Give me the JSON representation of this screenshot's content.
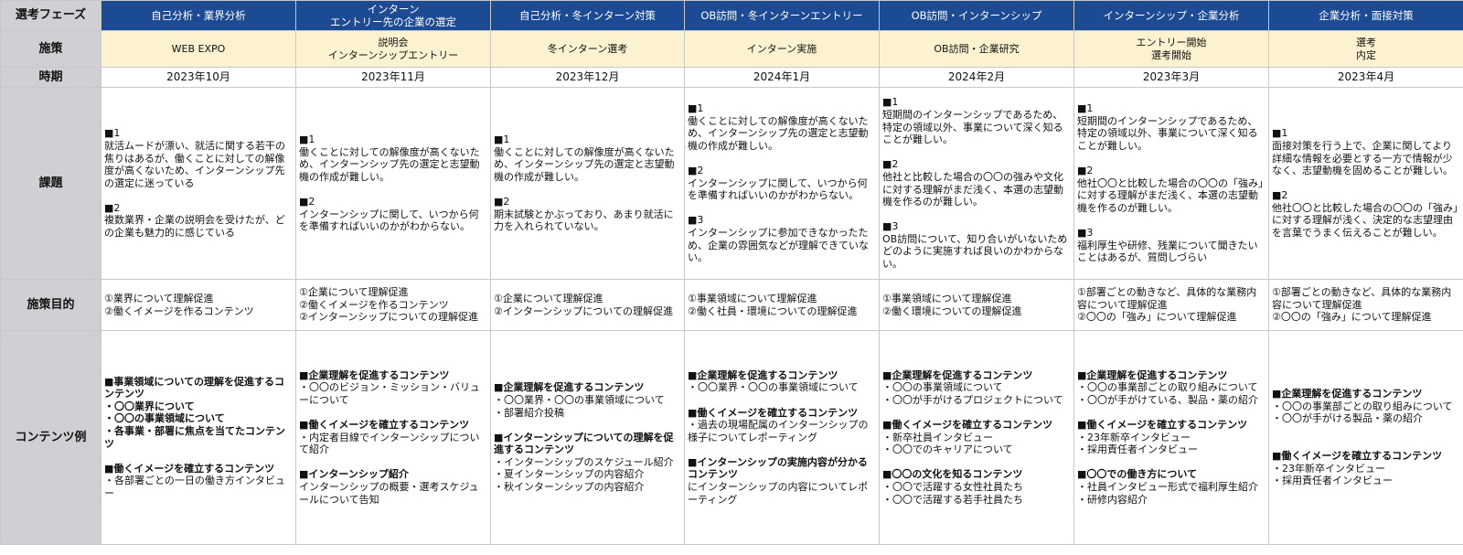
{
  "row_headers": {
    "phase": "選考フェーズ",
    "measure": "施策",
    "period": "時期",
    "challenges": "課題",
    "purpose": "施策目的",
    "content": "コンテンツ例"
  },
  "columns": [
    {
      "phase": "自己分析・業界分析",
      "measure": "WEB EXPO",
      "period": "2023年10月",
      "challenges": "■1\n就活ムードが漂い、就活に関する若干の焦りはあるが、働くことに対しての解像度が高くないため、インターンシップ先の選定に迷っている\n\n■2\n複数業界・企業の説明会を受けたが、どの企業も魅力的に感じている",
      "purpose": "①業界について理解促進\n②働くイメージを作るコンテンツ",
      "content": [
        {
          "text": "■事業領域についての理解を促進するコンテンツ",
          "bold": true
        },
        {
          "text": "・〇〇業界について",
          "bold": true
        },
        {
          "text": "・〇〇の事業領域について",
          "bold": true
        },
        {
          "text": "・各事業・部署に焦点を当てたコンテンツ",
          "bold": true
        },
        {
          "text": "",
          "bold": false
        },
        {
          "text": "■働くイメージを確立するコンテンツ",
          "bold": true
        },
        {
          "text": "・各部署ごとの一日の働き方インタビュー",
          "bold": false
        }
      ]
    },
    {
      "phase": "インターン\nエントリー先の企業の選定",
      "measure": "説明会\nインターンシップエントリー",
      "period": "2023年11月",
      "challenges": "■1\n働くことに対しての解像度が高くないため、インターンシップ先の選定と志望動機の作成が難しい。\n\n■2\nインターンシップに関して、いつから何を準備すればいいのかがわからない。",
      "purpose": "①企業について理解促進\n②働くイメージを作るコンテンツ\n②インターンシップについての理解促進",
      "content": [
        {
          "text": "■企業理解を促進するコンテンツ",
          "bold": true
        },
        {
          "text": "・〇〇のビジョン・ミッション・バリューについて",
          "bold": false
        },
        {
          "text": "",
          "bold": false
        },
        {
          "text": "■働くイメージを確立するコンテンツ",
          "bold": true
        },
        {
          "text": "・内定者目線でインターンシップについて紹介",
          "bold": false
        },
        {
          "text": "",
          "bold": false
        },
        {
          "text": "■インターンシップ紹介",
          "bold": true
        },
        {
          "text": "インターンシップの概要・選考スケジュールについて告知",
          "bold": false
        }
      ]
    },
    {
      "phase": "自己分析・冬インターン対策",
      "measure": "冬インターン選考",
      "period": "2023年12月",
      "challenges": "■1\n働くことに対しての解像度が高くないため、インターンシップ先の選定と志望動機の作成が難しい。\n\n■2\n期末試験とかぶっており、あまり就活に力を入れられていない。",
      "purpose": "①企業について理解促進\n②インターンシップについての理解促進",
      "content": [
        {
          "text": "■企業理解を促進するコンテンツ",
          "bold": true
        },
        {
          "text": "・〇〇業界・〇〇の事業領域について",
          "bold": false
        },
        {
          "text": "・部署紹介投稿",
          "bold": false
        },
        {
          "text": "",
          "bold": false
        },
        {
          "text": "■インターンシップについての理解を促進するコンテンツ",
          "bold": true
        },
        {
          "text": "・インターンシップのスケジュール紹介",
          "bold": false
        },
        {
          "text": "・夏インターンシップの内容紹介",
          "bold": false
        },
        {
          "text": "・秋インターンシップの内容紹介",
          "bold": false
        }
      ]
    },
    {
      "phase": "OB訪問・冬インターンエントリー",
      "measure": "インターン実施",
      "period": "2024年1月",
      "challenges": "■1\n働くことに対しての解像度が高くないため、インターンシップ先の選定と志望動機の作成が難しい。\n\n■2\nインターンシップに関して、いつから何を準備すればいいのかがわからない。\n\n■3\nインターンシップに参加できなかったため、企業の雰囲気などが理解できていない。",
      "purpose": "①事業領域について理解促進\n②働く社員・環境についての理解促進",
      "content": [
        {
          "text": "■企業理解を促進するコンテンツ",
          "bold": true
        },
        {
          "text": "・〇〇業界・〇〇の事業領域について",
          "bold": false
        },
        {
          "text": "",
          "bold": false
        },
        {
          "text": "■働くイメージを確立するコンテンツ",
          "bold": true
        },
        {
          "text": "・過去の現場配属のインターンシップの様子についてレポーティング",
          "bold": false
        },
        {
          "text": "",
          "bold": false
        },
        {
          "text": "■インターンシップの実施内容が分かるコンテンツ",
          "bold": true
        },
        {
          "text": "にインターンシップの内容についてレポーティング",
          "bold": false
        }
      ]
    },
    {
      "phase": "OB訪問・インターンシップ",
      "measure": "OB訪問・企業研究",
      "period": "2024年2月",
      "challenges": "■1\n短期間のインターンシップであるため、特定の領域以外、事業について深く知ることが難しい。\n\n■2\n他社と比較した場合の〇〇の強みや文化に対する理解がまだ浅く、本選の志望動機を作るのが難しい。\n\n■3\nOB訪問について、知り合いがいないためどのように実施すれば良いのかわからない。",
      "purpose": "①事業領域について理解促進\n②働く環境についての理解促進",
      "content": [
        {
          "text": "■企業理解を促進するコンテンツ",
          "bold": true
        },
        {
          "text": "・〇〇の事業領域について",
          "bold": false
        },
        {
          "text": "・〇〇が手がけるプロジェクトについて",
          "bold": false
        },
        {
          "text": "",
          "bold": false
        },
        {
          "text": "■働くイメージを確立するコンテンツ",
          "bold": true
        },
        {
          "text": "・新卒社員インタビュー",
          "bold": false
        },
        {
          "text": "・〇〇でのキャリアについて",
          "bold": false
        },
        {
          "text": "",
          "bold": false
        },
        {
          "text": "■〇〇の文化を知るコンテンツ",
          "bold": true
        },
        {
          "text": "・〇〇で活躍する女性社員たち",
          "bold": false
        },
        {
          "text": "・〇〇で活躍する若手社員たち",
          "bold": false
        }
      ]
    },
    {
      "phase": "インターンシップ・企業分析",
      "measure": "エントリー開始\n選考開始",
      "period": "2023年3月",
      "challenges": "■1\n短期間のインターンシップであるため、特定の領域以外、事業について深く知ることが難しい。\n\n■2\n他社〇〇と比較した場合の〇〇の「強み」に対する理解がまだ浅く、本選の志望動機を作るのが難しい。\n\n■3\n福利厚生や研修、残業について聞きたいことはあるが、質問しづらい",
      "purpose": "①部署ごとの動きなど、具体的な業務内容について理解促進\n②〇〇の「強み」について理解促進",
      "content": [
        {
          "text": "■企業理解を促進するコンテンツ",
          "bold": true
        },
        {
          "text": "・〇〇の事業部ごとの取り組みについて",
          "bold": false
        },
        {
          "text": "・〇〇が手がけている、製品・薬の紹介",
          "bold": false
        },
        {
          "text": "",
          "bold": false
        },
        {
          "text": "■働くイメージを確立するコンテンツ",
          "bold": true
        },
        {
          "text": "・23年新卒インタビュー",
          "bold": false
        },
        {
          "text": "・採用責任者インタビュー",
          "bold": false
        },
        {
          "text": "",
          "bold": false
        },
        {
          "text": "■〇〇での働き方について",
          "bold": true
        },
        {
          "text": "・社員インタビュー形式で福利厚生紹介",
          "bold": false
        },
        {
          "text": "・研修内容紹介",
          "bold": false
        }
      ]
    },
    {
      "phase": "企業分析・面接対策",
      "measure": "選考\n内定",
      "period": "2023年4月",
      "challenges": "■1\n面接対策を行う上で、企業に関してより詳細な情報を必要とする一方で情報が少なく、志望動機を固めることが難しい。\n\n■2\n他社〇〇と比較した場合の〇〇の「強み」に対する理解が浅く、決定的な志望理由を言葉でうまく伝えることが難しい。",
      "purpose": "①部署ごとの動きなど、具体的な業務内容について理解促進\n②〇〇の「強み」について理解促進",
      "content": [
        {
          "text": "■企業理解を促進するコンテンツ",
          "bold": true
        },
        {
          "text": "・〇〇の事業部ごとの取り組みについて",
          "bold": false
        },
        {
          "text": "・〇〇が手がける製品・薬の紹介",
          "bold": false
        },
        {
          "text": "",
          "bold": false
        },
        {
          "text": "",
          "bold": false
        },
        {
          "text": "■働くイメージを確立するコンテンツ",
          "bold": true
        },
        {
          "text": "・23年新卒インタビュー",
          "bold": false
        },
        {
          "text": "・採用責任者インタビュー",
          "bold": false
        }
      ]
    }
  ]
}
